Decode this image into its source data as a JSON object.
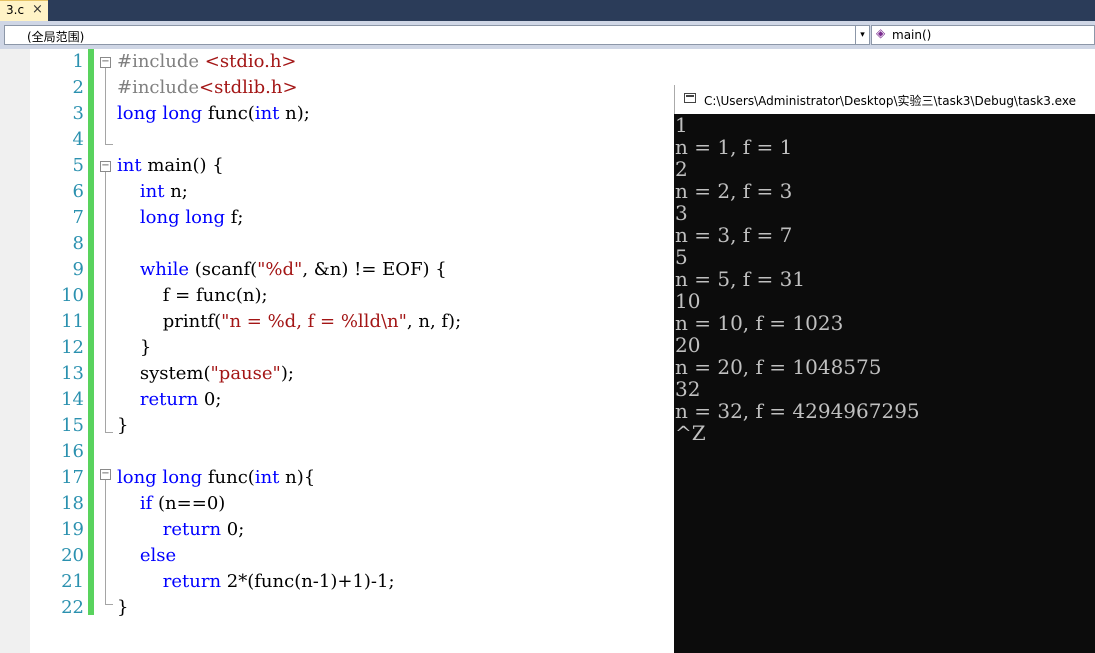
{
  "tab": {
    "label": "3.c",
    "close": "×"
  },
  "navbar": {
    "scope": "(全局范围)",
    "scope_arrow": "▾",
    "member_icon": "◈",
    "member": "main()"
  },
  "editor": {
    "line_numbers": [
      "1",
      "2",
      "3",
      "4",
      "5",
      "6",
      "7",
      "8",
      "9",
      "10",
      "11",
      "12",
      "13",
      "14",
      "15",
      "16",
      "17",
      "18",
      "19",
      "20",
      "21",
      "22"
    ],
    "code": {
      "l1_a": "#include ",
      "l1_b": "<stdio.h>",
      "l2_a": "#include",
      "l2_b": "<stdlib.h>",
      "l3_a": "long long",
      "l3_b": " func(",
      "l3_c": "int",
      "l3_d": " n);",
      "l5_a": "int",
      "l5_b": " main() {",
      "l6_a": "    ",
      "l6_b": "int",
      "l6_c": " n;",
      "l7_a": "    ",
      "l7_b": "long long",
      "l7_c": " f;",
      "l9_a": "    ",
      "l9_b": "while",
      "l9_c": " (scanf(",
      "l9_d": "\"%d\"",
      "l9_e": ", &n) != EOF) {",
      "l10": "        f = func(n);",
      "l11_a": "        printf(",
      "l11_b": "\"n = %d, f = %lld\\n\"",
      "l11_c": ", n, f);",
      "l12": "    }",
      "l13_a": "    system(",
      "l13_b": "\"pause\"",
      "l13_c": ");",
      "l14_a": "    ",
      "l14_b": "return",
      "l14_c": " 0;",
      "l15": "}",
      "l17_a": "long long",
      "l17_b": " func(",
      "l17_c": "int",
      "l17_d": " n){",
      "l18_a": "    ",
      "l18_b": "if",
      "l18_c": " (n==0)",
      "l19_a": "        ",
      "l19_b": "return",
      "l19_c": " 0;",
      "l20_a": "    ",
      "l20_b": "else",
      "l21_a": "        ",
      "l21_b": "return",
      "l21_c": " 2*(func(n-1)+1)-1;",
      "l22": "}"
    },
    "fold_symbol": "−"
  },
  "console": {
    "title": "C:\\Users\\Administrator\\Desktop\\实验三\\task3\\Debug\\task3.exe",
    "lines": [
      "1",
      "n = 1, f = 1",
      "2",
      "n = 2, f = 3",
      "3",
      "n = 3, f = 7",
      "5",
      "n = 5, f = 31",
      "10",
      "n = 10, f = 1023",
      "20",
      "n = 20, f = 1048575",
      "32",
      "n = 32, f = 4294967295",
      "^Z"
    ]
  }
}
